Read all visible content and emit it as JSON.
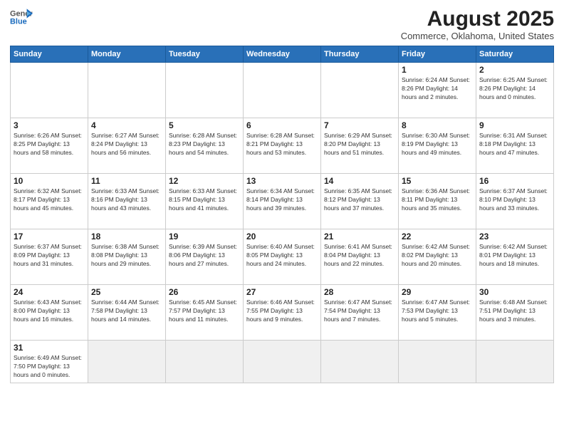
{
  "header": {
    "logo_line1": "General",
    "logo_line2": "Blue",
    "title": "August 2025",
    "subtitle": "Commerce, Oklahoma, United States"
  },
  "calendar": {
    "days_of_week": [
      "Sunday",
      "Monday",
      "Tuesday",
      "Wednesday",
      "Thursday",
      "Friday",
      "Saturday"
    ],
    "weeks": [
      [
        {
          "day": "",
          "info": ""
        },
        {
          "day": "",
          "info": ""
        },
        {
          "day": "",
          "info": ""
        },
        {
          "day": "",
          "info": ""
        },
        {
          "day": "",
          "info": ""
        },
        {
          "day": "1",
          "info": "Sunrise: 6:24 AM\nSunset: 8:26 PM\nDaylight: 14 hours\nand 2 minutes."
        },
        {
          "day": "2",
          "info": "Sunrise: 6:25 AM\nSunset: 8:26 PM\nDaylight: 14 hours\nand 0 minutes."
        }
      ],
      [
        {
          "day": "3",
          "info": "Sunrise: 6:26 AM\nSunset: 8:25 PM\nDaylight: 13 hours\nand 58 minutes."
        },
        {
          "day": "4",
          "info": "Sunrise: 6:27 AM\nSunset: 8:24 PM\nDaylight: 13 hours\nand 56 minutes."
        },
        {
          "day": "5",
          "info": "Sunrise: 6:28 AM\nSunset: 8:23 PM\nDaylight: 13 hours\nand 54 minutes."
        },
        {
          "day": "6",
          "info": "Sunrise: 6:28 AM\nSunset: 8:21 PM\nDaylight: 13 hours\nand 53 minutes."
        },
        {
          "day": "7",
          "info": "Sunrise: 6:29 AM\nSunset: 8:20 PM\nDaylight: 13 hours\nand 51 minutes."
        },
        {
          "day": "8",
          "info": "Sunrise: 6:30 AM\nSunset: 8:19 PM\nDaylight: 13 hours\nand 49 minutes."
        },
        {
          "day": "9",
          "info": "Sunrise: 6:31 AM\nSunset: 8:18 PM\nDaylight: 13 hours\nand 47 minutes."
        }
      ],
      [
        {
          "day": "10",
          "info": "Sunrise: 6:32 AM\nSunset: 8:17 PM\nDaylight: 13 hours\nand 45 minutes."
        },
        {
          "day": "11",
          "info": "Sunrise: 6:33 AM\nSunset: 8:16 PM\nDaylight: 13 hours\nand 43 minutes."
        },
        {
          "day": "12",
          "info": "Sunrise: 6:33 AM\nSunset: 8:15 PM\nDaylight: 13 hours\nand 41 minutes."
        },
        {
          "day": "13",
          "info": "Sunrise: 6:34 AM\nSunset: 8:14 PM\nDaylight: 13 hours\nand 39 minutes."
        },
        {
          "day": "14",
          "info": "Sunrise: 6:35 AM\nSunset: 8:12 PM\nDaylight: 13 hours\nand 37 minutes."
        },
        {
          "day": "15",
          "info": "Sunrise: 6:36 AM\nSunset: 8:11 PM\nDaylight: 13 hours\nand 35 minutes."
        },
        {
          "day": "16",
          "info": "Sunrise: 6:37 AM\nSunset: 8:10 PM\nDaylight: 13 hours\nand 33 minutes."
        }
      ],
      [
        {
          "day": "17",
          "info": "Sunrise: 6:37 AM\nSunset: 8:09 PM\nDaylight: 13 hours\nand 31 minutes."
        },
        {
          "day": "18",
          "info": "Sunrise: 6:38 AM\nSunset: 8:08 PM\nDaylight: 13 hours\nand 29 minutes."
        },
        {
          "day": "19",
          "info": "Sunrise: 6:39 AM\nSunset: 8:06 PM\nDaylight: 13 hours\nand 27 minutes."
        },
        {
          "day": "20",
          "info": "Sunrise: 6:40 AM\nSunset: 8:05 PM\nDaylight: 13 hours\nand 24 minutes."
        },
        {
          "day": "21",
          "info": "Sunrise: 6:41 AM\nSunset: 8:04 PM\nDaylight: 13 hours\nand 22 minutes."
        },
        {
          "day": "22",
          "info": "Sunrise: 6:42 AM\nSunset: 8:02 PM\nDaylight: 13 hours\nand 20 minutes."
        },
        {
          "day": "23",
          "info": "Sunrise: 6:42 AM\nSunset: 8:01 PM\nDaylight: 13 hours\nand 18 minutes."
        }
      ],
      [
        {
          "day": "24",
          "info": "Sunrise: 6:43 AM\nSunset: 8:00 PM\nDaylight: 13 hours\nand 16 minutes."
        },
        {
          "day": "25",
          "info": "Sunrise: 6:44 AM\nSunset: 7:58 PM\nDaylight: 13 hours\nand 14 minutes."
        },
        {
          "day": "26",
          "info": "Sunrise: 6:45 AM\nSunset: 7:57 PM\nDaylight: 13 hours\nand 11 minutes."
        },
        {
          "day": "27",
          "info": "Sunrise: 6:46 AM\nSunset: 7:55 PM\nDaylight: 13 hours\nand 9 minutes."
        },
        {
          "day": "28",
          "info": "Sunrise: 6:47 AM\nSunset: 7:54 PM\nDaylight: 13 hours\nand 7 minutes."
        },
        {
          "day": "29",
          "info": "Sunrise: 6:47 AM\nSunset: 7:53 PM\nDaylight: 13 hours\nand 5 minutes."
        },
        {
          "day": "30",
          "info": "Sunrise: 6:48 AM\nSunset: 7:51 PM\nDaylight: 13 hours\nand 3 minutes."
        }
      ],
      [
        {
          "day": "31",
          "info": "Sunrise: 6:49 AM\nSunset: 7:50 PM\nDaylight: 13 hours\nand 0 minutes."
        },
        {
          "day": "",
          "info": ""
        },
        {
          "day": "",
          "info": ""
        },
        {
          "day": "",
          "info": ""
        },
        {
          "day": "",
          "info": ""
        },
        {
          "day": "",
          "info": ""
        },
        {
          "day": "",
          "info": ""
        }
      ]
    ]
  }
}
